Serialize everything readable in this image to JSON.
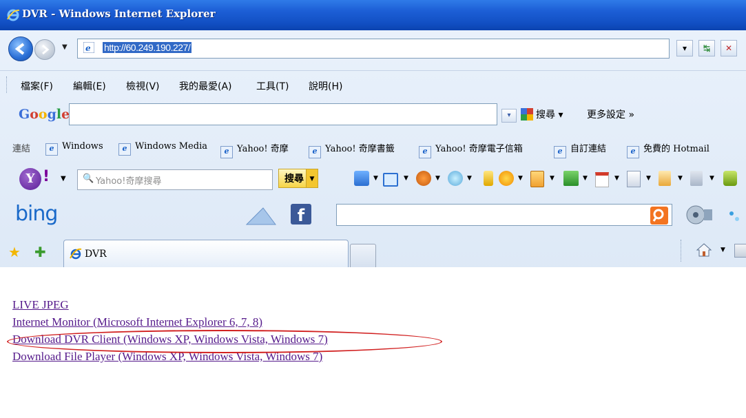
{
  "window": {
    "title": "DVR - Windows Internet Explorer"
  },
  "address_bar": {
    "url": "http://60.249.190.227/"
  },
  "menu": [
    "檔案(F)",
    "編輯(E)",
    "檢視(V)",
    "我的最愛(A)",
    "工具(T)",
    "說明(H)"
  ],
  "google_toolbar": {
    "logo": "Google",
    "search_label": "搜尋",
    "settings_label": "更多設定 »"
  },
  "links_bar": {
    "label": "連結",
    "items": [
      "Windows",
      "Windows Media",
      "Yahoo! 奇摩",
      "Yahoo! 奇摩書籤",
      "Yahoo! 奇摩電子信箱",
      "自訂連結",
      "免費的 Hotmail"
    ]
  },
  "yahoo_toolbar": {
    "logo": "Y",
    "placeholder": "Yahoo!奇摩搜尋",
    "search_label": "搜尋"
  },
  "bing_toolbar": {
    "logo": "bing"
  },
  "tabs": [
    {
      "label": "DVR"
    }
  ],
  "page": {
    "links": [
      "LIVE JPEG",
      "Internet Monitor (Microsoft Internet Explorer 6, 7, 8)",
      "Download DVR Client (Windows XP, Windows Vista, Windows 7)",
      "Download File Player (Windows XP, Windows Vista, Windows 7)"
    ],
    "highlighted_link_index": 2,
    "highlight_color": "#d12020",
    "link_color": "#551a8b"
  }
}
